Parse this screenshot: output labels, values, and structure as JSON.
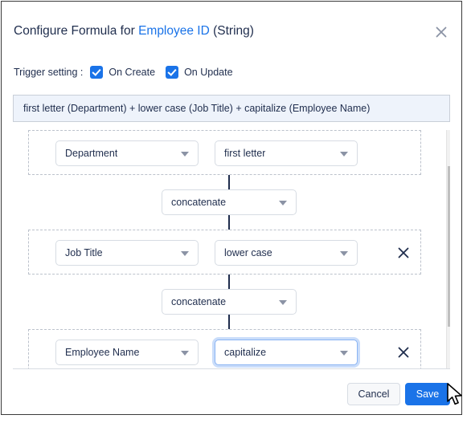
{
  "dialog": {
    "title_prefix": "Configure Formula for ",
    "title_field": "Employee ID",
    "title_suffix": " (String)",
    "close_icon": "close-icon"
  },
  "trigger": {
    "label": "Trigger setting :",
    "options": [
      {
        "label": "On Create",
        "checked": true
      },
      {
        "label": "On Update",
        "checked": true
      }
    ]
  },
  "formula": {
    "expression": "first letter (Department) + lower case (Job Title) + capitalize (Employee Name)"
  },
  "builder": {
    "rows": [
      {
        "field": "Department",
        "function": "first letter",
        "removable": false,
        "focused": false
      },
      {
        "field": "Job Title",
        "function": "lower case",
        "removable": true,
        "focused": false
      },
      {
        "field": "Employee Name",
        "function": "capitalize",
        "removable": true,
        "focused": true
      }
    ],
    "operators": [
      {
        "value": "concatenate"
      },
      {
        "value": "concatenate"
      }
    ],
    "remove_icon": "close-icon",
    "caret_icon": "chevron-down-icon"
  },
  "scrollbar": {
    "up_icon": "arrow-up-icon",
    "down_icon": "arrow-down-icon"
  },
  "footer": {
    "cancel_label": "Cancel",
    "save_label": "Save"
  },
  "colors": {
    "accent": "#1a73e8",
    "text": "#1f2d4d",
    "formula_bg": "#eef3fb",
    "connector": "#1f2d4d"
  }
}
